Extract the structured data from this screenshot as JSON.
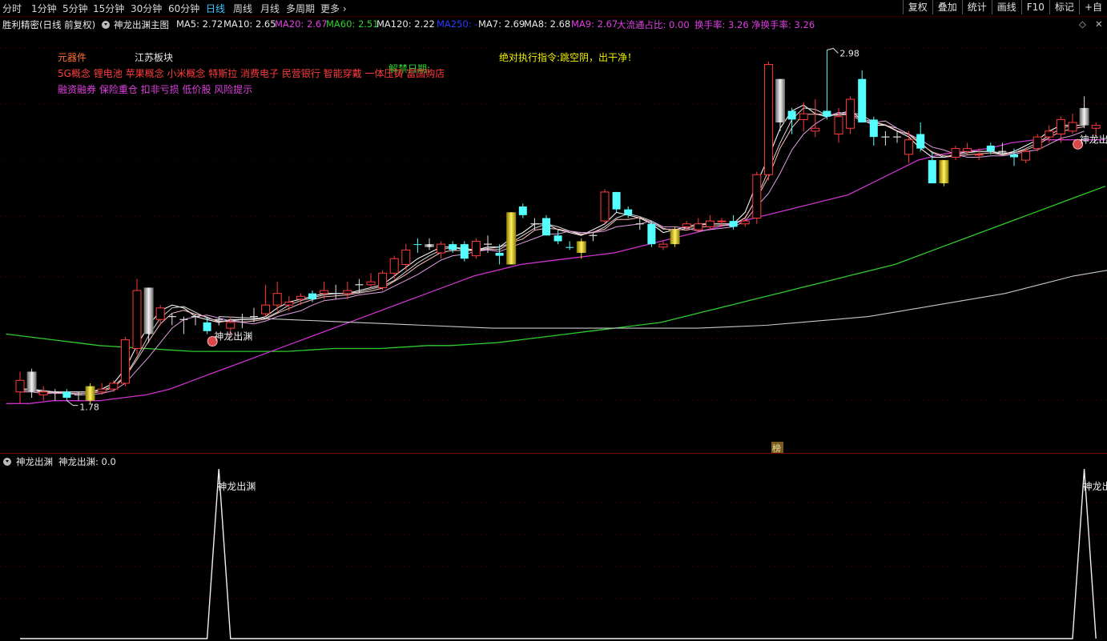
{
  "periods": [
    "分时",
    "1分钟",
    "5分钟",
    "15分钟",
    "30分钟",
    "60分钟",
    "日线",
    "周线",
    "月线",
    "多周期",
    "更多"
  ],
  "active_period": "日线",
  "toolbar": [
    "复权",
    "叠加",
    "统计",
    "画线",
    "F10",
    "标记",
    "+自"
  ],
  "title_bar": {
    "name": "胜利精密(日线 前复权)",
    "indicator": "神龙出渊主图",
    "ma": [
      {
        "label": "MA5: 2.72",
        "color": "#e8e8e8"
      },
      {
        "label": "MA10: 2.65",
        "color": "#e8e8e8"
      },
      {
        "label": "MA20: 2.67",
        "color": "#e040e0"
      },
      {
        "label": "MA60: 2.51",
        "color": "#30d030"
      },
      {
        "label": "MA120: 2.22",
        "color": "#e8e8e8"
      },
      {
        "label": "MA250: -",
        "color": "#2a3cff"
      },
      {
        "label": "MA7: 2.69",
        "color": "#e8e8e8"
      },
      {
        "label": "MA8: 2.68",
        "color": "#e8e8e8"
      },
      {
        "label": "MA9: 2.67",
        "color": "#e040e0"
      },
      {
        "label": "大流通占比: 0.00",
        "color": "#e040e0"
      },
      {
        "label": "换手率: 3.26",
        "color": "#e040e0"
      },
      {
        "label": "净换手率: 3.26",
        "color": "#e040e0"
      }
    ]
  },
  "annotations": {
    "industry": "元器件",
    "region": "江苏板块",
    "unlock_label": "解禁日期:",
    "command": "绝对执行指令:跳空阴，出干净！",
    "concepts": "5G概念 锂电池 苹果概念 小米概念 特斯拉 消费电子 民营银行 智能穿戴 一体压铸 富国购店",
    "tags": "融资融券 保险重仓 扣非亏损 低价股 风险提示",
    "signal_label": "神龙出渊",
    "high_label": "2.98",
    "low_label": "1.78",
    "bang_label": "榜"
  },
  "sub_panel": {
    "title": "神龙出渊",
    "value_label": "神龙出渊: 0.0",
    "peak_label": "神龙出渊"
  },
  "colors": {
    "up": "#ff3c3c",
    "down": "#54ffff",
    "gold": "#e8d800",
    "gray": "#bfbfbf",
    "ma60": "#2ecc2e",
    "ma20": "#cc33cc",
    "ma120": "#c8c8c8"
  },
  "chart_data": {
    "type": "candlestick",
    "y_range": [
      1.7,
      3.02
    ],
    "candles": [
      {
        "o": 1.8,
        "h": 1.87,
        "l": 1.76,
        "c": 1.84,
        "t": "up"
      },
      {
        "o": 1.8,
        "h": 1.88,
        "l": 1.78,
        "c": 1.87,
        "t": "gray"
      },
      {
        "o": 1.8,
        "h": 1.82,
        "l": 1.77,
        "c": 1.79,
        "t": "up"
      },
      {
        "o": 1.8,
        "h": 1.81,
        "l": 1.77,
        "c": 1.8,
        "t": "flat"
      },
      {
        "o": 1.8,
        "h": 1.81,
        "l": 1.77,
        "c": 1.78,
        "t": "down"
      },
      {
        "o": 1.79,
        "h": 1.8,
        "l": 1.77,
        "c": 1.78,
        "t": "flat"
      },
      {
        "o": 1.77,
        "h": 1.83,
        "l": 1.76,
        "c": 1.82,
        "t": "gold"
      },
      {
        "o": 1.8,
        "h": 1.83,
        "l": 1.79,
        "c": 1.81,
        "t": "up"
      },
      {
        "o": 1.81,
        "h": 1.84,
        "l": 1.8,
        "c": 1.83,
        "t": "up"
      },
      {
        "o": 1.83,
        "h": 1.99,
        "l": 1.82,
        "c": 1.98,
        "t": "up"
      },
      {
        "o": 1.95,
        "h": 2.19,
        "l": 1.93,
        "c": 2.15,
        "t": "up"
      },
      {
        "o": 2.0,
        "h": 2.16,
        "l": 1.97,
        "c": 2.16,
        "t": "gray"
      },
      {
        "o": 2.05,
        "h": 2.1,
        "l": 2.03,
        "c": 2.09,
        "t": "up"
      },
      {
        "o": 2.04,
        "h": 2.07,
        "l": 2.03,
        "c": 2.06,
        "t": "flat"
      },
      {
        "o": 2.05,
        "h": 2.06,
        "l": 2.0,
        "c": 2.04,
        "t": "flat"
      },
      {
        "o": 2.05,
        "h": 2.07,
        "l": 2.03,
        "c": 2.06,
        "t": "flat"
      },
      {
        "o": 2.04,
        "h": 2.06,
        "l": 2.0,
        "c": 2.01,
        "t": "down"
      },
      {
        "o": 2.04,
        "h": 2.06,
        "l": 2.03,
        "c": 2.05,
        "t": "flat"
      },
      {
        "o": 2.02,
        "h": 2.06,
        "l": 1.99,
        "c": 2.04,
        "t": "up"
      },
      {
        "o": 2.04,
        "h": 2.07,
        "l": 2.02,
        "c": 2.05,
        "t": "flat"
      },
      {
        "o": 2.05,
        "h": 2.09,
        "l": 2.04,
        "c": 2.06,
        "t": "flat"
      },
      {
        "o": 2.07,
        "h": 2.17,
        "l": 2.06,
        "c": 2.1,
        "t": "up"
      },
      {
        "o": 2.1,
        "h": 2.18,
        "l": 2.08,
        "c": 2.14,
        "t": "up"
      },
      {
        "o": 2.1,
        "h": 2.13,
        "l": 2.08,
        "c": 2.11,
        "t": "up"
      },
      {
        "o": 2.13,
        "h": 2.14,
        "l": 2.1,
        "c": 2.12,
        "t": "up"
      },
      {
        "o": 2.14,
        "h": 2.15,
        "l": 2.11,
        "c": 2.12,
        "t": "down"
      },
      {
        "o": 2.14,
        "h": 2.18,
        "l": 2.12,
        "c": 2.15,
        "t": "up"
      },
      {
        "o": 2.14,
        "h": 2.17,
        "l": 2.12,
        "c": 2.14,
        "t": "flat"
      },
      {
        "o": 2.14,
        "h": 2.18,
        "l": 2.12,
        "c": 2.15,
        "t": "up"
      },
      {
        "o": 2.16,
        "h": 2.19,
        "l": 2.14,
        "c": 2.17,
        "t": "flat"
      },
      {
        "o": 2.17,
        "h": 2.21,
        "l": 2.16,
        "c": 2.18,
        "t": "up"
      },
      {
        "o": 2.16,
        "h": 2.22,
        "l": 2.15,
        "c": 2.21,
        "t": "up"
      },
      {
        "o": 2.21,
        "h": 2.27,
        "l": 2.19,
        "c": 2.26,
        "t": "up"
      },
      {
        "o": 2.24,
        "h": 2.31,
        "l": 2.22,
        "c": 2.29,
        "t": "up"
      },
      {
        "o": 2.31,
        "h": 2.33,
        "l": 2.28,
        "c": 2.31,
        "t": "down"
      },
      {
        "o": 2.31,
        "h": 2.33,
        "l": 2.29,
        "c": 2.3,
        "t": "gray"
      },
      {
        "o": 2.28,
        "h": 2.32,
        "l": 2.26,
        "c": 2.31,
        "t": "up"
      },
      {
        "o": 2.29,
        "h": 2.32,
        "l": 2.28,
        "c": 2.31,
        "t": "down"
      },
      {
        "o": 2.31,
        "h": 2.32,
        "l": 2.25,
        "c": 2.26,
        "t": "down"
      },
      {
        "o": 2.27,
        "h": 2.33,
        "l": 2.26,
        "c": 2.32,
        "t": "up"
      },
      {
        "o": 2.3,
        "h": 2.34,
        "l": 2.28,
        "c": 2.31,
        "t": "flat"
      },
      {
        "o": 2.27,
        "h": 2.31,
        "l": 2.24,
        "c": 2.28,
        "t": "down"
      },
      {
        "o": 2.24,
        "h": 2.42,
        "l": 2.24,
        "c": 2.42,
        "t": "gold"
      },
      {
        "o": 2.44,
        "h": 2.45,
        "l": 2.4,
        "c": 2.41,
        "t": "down"
      },
      {
        "o": 2.38,
        "h": 2.4,
        "l": 2.36,
        "c": 2.38,
        "t": "flat"
      },
      {
        "o": 2.4,
        "h": 2.41,
        "l": 2.34,
        "c": 2.34,
        "t": "down"
      },
      {
        "o": 2.34,
        "h": 2.36,
        "l": 2.31,
        "c": 2.32,
        "t": "down"
      },
      {
        "o": 2.3,
        "h": 2.32,
        "l": 2.29,
        "c": 2.3,
        "t": "down"
      },
      {
        "o": 2.28,
        "h": 2.33,
        "l": 2.26,
        "c": 2.32,
        "t": "gold"
      },
      {
        "o": 2.33,
        "h": 2.35,
        "l": 2.32,
        "c": 2.34,
        "t": "flat"
      },
      {
        "o": 2.39,
        "h": 2.5,
        "l": 2.38,
        "c": 2.49,
        "t": "up"
      },
      {
        "o": 2.49,
        "h": 2.49,
        "l": 2.42,
        "c": 2.43,
        "t": "down"
      },
      {
        "o": 2.43,
        "h": 2.44,
        "l": 2.4,
        "c": 2.41,
        "t": "down"
      },
      {
        "o": 2.38,
        "h": 2.4,
        "l": 2.36,
        "c": 2.37,
        "t": "flat"
      },
      {
        "o": 2.38,
        "h": 2.39,
        "l": 2.3,
        "c": 2.31,
        "t": "down"
      },
      {
        "o": 2.31,
        "h": 2.32,
        "l": 2.29,
        "c": 2.3,
        "t": "up"
      },
      {
        "o": 2.31,
        "h": 2.37,
        "l": 2.3,
        "c": 2.36,
        "t": "gold"
      },
      {
        "o": 2.37,
        "h": 2.39,
        "l": 2.36,
        "c": 2.38,
        "t": "up"
      },
      {
        "o": 2.36,
        "h": 2.4,
        "l": 2.35,
        "c": 2.38,
        "t": "up"
      },
      {
        "o": 2.37,
        "h": 2.41,
        "l": 2.36,
        "c": 2.39,
        "t": "up"
      },
      {
        "o": 2.39,
        "h": 2.4,
        "l": 2.37,
        "c": 2.39,
        "t": "up"
      },
      {
        "o": 2.39,
        "h": 2.41,
        "l": 2.36,
        "c": 2.37,
        "t": "down"
      },
      {
        "o": 2.39,
        "h": 2.4,
        "l": 2.37,
        "c": 2.38,
        "t": "up"
      },
      {
        "o": 2.4,
        "h": 2.56,
        "l": 2.38,
        "c": 2.55,
        "t": "up"
      },
      {
        "o": 2.55,
        "h": 2.94,
        "l": 2.53,
        "c": 2.93,
        "t": "up"
      },
      {
        "o": 2.88,
        "h": 2.88,
        "l": 2.7,
        "c": 2.73,
        "t": "gray"
      },
      {
        "o": 2.77,
        "h": 2.78,
        "l": 2.69,
        "c": 2.74,
        "t": "down"
      },
      {
        "o": 2.74,
        "h": 2.8,
        "l": 2.7,
        "c": 2.76,
        "t": "up"
      },
      {
        "o": 2.7,
        "h": 2.81,
        "l": 2.68,
        "c": 2.71,
        "t": "up"
      },
      {
        "o": 2.77,
        "h": 2.98,
        "l": 2.74,
        "c": 2.75,
        "t": "down"
      },
      {
        "o": 2.75,
        "h": 2.78,
        "l": 2.66,
        "c": 2.69,
        "t": "up"
      },
      {
        "o": 2.71,
        "h": 2.82,
        "l": 2.69,
        "c": 2.81,
        "t": "up"
      },
      {
        "o": 2.88,
        "h": 2.91,
        "l": 2.73,
        "c": 2.73,
        "t": "down"
      },
      {
        "o": 2.74,
        "h": 2.75,
        "l": 2.65,
        "c": 2.68,
        "t": "down"
      },
      {
        "o": 2.68,
        "h": 2.7,
        "l": 2.65,
        "c": 2.68,
        "t": "flat"
      },
      {
        "o": 2.68,
        "h": 2.7,
        "l": 2.66,
        "c": 2.68,
        "t": "flat"
      },
      {
        "o": 2.62,
        "h": 2.7,
        "l": 2.59,
        "c": 2.67,
        "t": "up"
      },
      {
        "o": 2.69,
        "h": 2.73,
        "l": 2.63,
        "c": 2.64,
        "t": "down"
      },
      {
        "o": 2.6,
        "h": 2.63,
        "l": 2.52,
        "c": 2.52,
        "t": "down"
      },
      {
        "o": 2.52,
        "h": 2.6,
        "l": 2.51,
        "c": 2.6,
        "t": "gold"
      },
      {
        "o": 2.61,
        "h": 2.65,
        "l": 2.6,
        "c": 2.64,
        "t": "up"
      },
      {
        "o": 2.63,
        "h": 2.66,
        "l": 2.62,
        "c": 2.64,
        "t": "up"
      },
      {
        "o": 2.62,
        "h": 2.64,
        "l": 2.6,
        "c": 2.62,
        "t": "up"
      },
      {
        "o": 2.65,
        "h": 2.66,
        "l": 2.62,
        "c": 2.63,
        "t": "down"
      },
      {
        "o": 2.62,
        "h": 2.66,
        "l": 2.62,
        "c": 2.63,
        "t": "flat"
      },
      {
        "o": 2.61,
        "h": 2.64,
        "l": 2.58,
        "c": 2.62,
        "t": "down"
      },
      {
        "o": 2.6,
        "h": 2.64,
        "l": 2.59,
        "c": 2.63,
        "t": "up"
      },
      {
        "o": 2.64,
        "h": 2.69,
        "l": 2.63,
        "c": 2.68,
        "t": "up"
      },
      {
        "o": 2.68,
        "h": 2.72,
        "l": 2.66,
        "c": 2.7,
        "t": "up"
      },
      {
        "o": 2.69,
        "h": 2.75,
        "l": 2.66,
        "c": 2.74,
        "t": "up"
      },
      {
        "o": 2.7,
        "h": 2.76,
        "l": 2.69,
        "c": 2.73,
        "t": "up"
      },
      {
        "o": 2.78,
        "h": 2.82,
        "l": 2.71,
        "c": 2.72,
        "t": "gray"
      },
      {
        "o": 2.71,
        "h": 2.73,
        "l": 2.68,
        "c": 2.72,
        "t": "up"
      }
    ],
    "signal_bars": [
      17,
      91
    ],
    "sub_series": [
      0,
      0,
      0,
      0,
      0,
      0,
      0,
      0,
      0,
      0,
      0,
      0,
      0,
      0,
      0,
      0,
      0,
      1,
      0,
      0,
      0,
      0,
      0,
      0,
      0,
      0,
      0,
      0,
      0,
      0,
      0,
      0,
      0,
      0,
      0,
      0,
      0,
      0,
      0,
      0,
      0,
      0,
      0,
      0,
      0,
      0,
      0,
      0,
      0,
      0,
      0,
      0,
      0,
      0,
      0,
      0,
      0,
      0,
      0,
      0,
      0,
      0,
      0,
      0,
      0,
      0,
      0,
      0,
      0,
      0,
      0,
      0,
      0,
      0,
      0,
      0,
      0,
      0,
      0,
      0,
      0,
      0,
      0,
      0,
      0,
      0,
      0,
      0,
      0,
      0,
      0,
      1,
      0,
      0,
      0,
      0,
      0,
      0,
      0,
      0,
      0,
      0,
      0,
      0,
      0,
      0,
      0,
      0,
      0,
      0,
      0,
      0,
      0,
      0,
      0,
      0,
      0,
      0,
      0,
      0
    ],
    "ma60": [
      2.0,
      1.99,
      1.98,
      1.97,
      1.96,
      1.955,
      1.95,
      1.945,
      1.94,
      1.94,
      1.94,
      1.94,
      1.94,
      1.945,
      1.95,
      1.95,
      1.95,
      1.955,
      1.96,
      1.96,
      1.965,
      1.97,
      1.98,
      1.99,
      2.0,
      2.01,
      2.02,
      2.03,
      2.04,
      2.06,
      2.08,
      2.1,
      2.12,
      2.14,
      2.16,
      2.18,
      2.2,
      2.22,
      2.24,
      2.27,
      2.3,
      2.33,
      2.36,
      2.39,
      2.42,
      2.45,
      2.48,
      2.51
    ],
    "ma20": [
      1.76,
      1.76,
      1.77,
      1.77,
      1.77,
      1.78,
      1.79,
      1.81,
      1.84,
      1.87,
      1.9,
      1.93,
      1.96,
      1.99,
      2.02,
      2.05,
      2.08,
      2.11,
      2.14,
      2.17,
      2.2,
      2.22,
      2.24,
      2.25,
      2.26,
      2.27,
      2.28,
      2.3,
      2.32,
      2.34,
      2.36,
      2.38,
      2.4,
      2.42,
      2.44,
      2.46,
      2.48,
      2.52,
      2.56,
      2.6,
      2.62,
      2.63,
      2.64,
      2.66,
      2.67,
      2.67,
      2.67,
      2.67
    ],
    "ma120": [
      2.06,
      2.055,
      2.05,
      2.045,
      2.04,
      2.035,
      2.03,
      2.025,
      2.02,
      2.02,
      2.02,
      2.02,
      2.02,
      2.02,
      2.02,
      2.025,
      2.03,
      2.04,
      2.05,
      2.06,
      2.08,
      2.1,
      2.12,
      2.14,
      2.17,
      2.2,
      2.22
    ],
    "ma5": [
      1.81,
      1.81,
      1.8,
      1.8,
      1.8,
      1.8,
      1.8,
      1.81,
      1.83,
      1.88,
      1.96,
      2.03,
      2.08,
      2.1,
      2.09,
      2.06,
      2.05,
      2.04,
      2.05,
      2.05,
      2.05,
      2.06,
      2.09,
      2.11,
      2.12,
      2.13,
      2.14,
      2.14,
      2.14,
      2.15,
      2.16,
      2.17,
      2.2,
      2.23,
      2.26,
      2.28,
      2.3,
      2.3,
      2.29,
      2.29,
      2.3,
      2.3,
      2.33,
      2.35,
      2.38,
      2.38,
      2.36,
      2.35,
      2.34,
      2.36,
      2.38,
      2.42,
      2.41,
      2.4,
      2.38,
      2.35,
      2.36,
      2.37,
      2.38,
      2.38,
      2.38,
      2.38,
      2.42,
      2.52,
      2.61,
      2.71,
      2.77,
      2.79,
      2.76,
      2.75,
      2.76,
      2.77,
      2.74,
      2.72,
      2.72,
      2.7,
      2.68,
      2.64,
      2.61,
      2.61,
      2.62,
      2.63,
      2.63,
      2.63,
      2.62,
      2.63,
      2.65,
      2.67,
      2.7,
      2.72,
      2.72,
      2.72
    ]
  }
}
